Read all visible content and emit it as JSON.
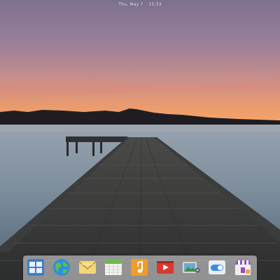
{
  "topbar": {
    "date": "Thu, May 7",
    "time": "15:33"
  },
  "wallpaper": {
    "subject": "wooden pier over calm lake at dusk",
    "sky_top": "#8a7b95",
    "horizon": "#e8956c",
    "water": "#6c7f8f"
  },
  "dock": {
    "items": [
      {
        "name": "multitasking-view",
        "icon": "grid-icon"
      },
      {
        "name": "web-browser",
        "icon": "globe-icon"
      },
      {
        "name": "mail",
        "icon": "envelope-icon"
      },
      {
        "name": "calendar",
        "icon": "calendar-icon"
      },
      {
        "name": "music",
        "icon": "music-note-icon"
      },
      {
        "name": "videos",
        "icon": "play-icon"
      },
      {
        "name": "photos",
        "icon": "photos-icon"
      },
      {
        "name": "system-settings",
        "icon": "toggle-icon"
      },
      {
        "name": "app-center",
        "icon": "store-icon"
      }
    ]
  }
}
